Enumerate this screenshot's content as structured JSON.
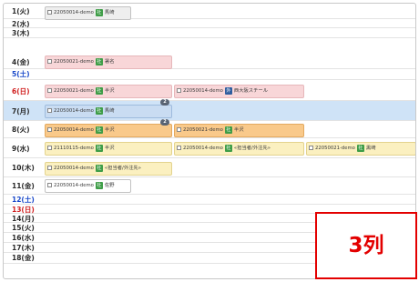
{
  "days": [
    {
      "label": "1(火)",
      "color": "default"
    },
    {
      "label": "2(水)",
      "color": "default"
    },
    {
      "label": "3(木)",
      "color": "default"
    },
    {
      "label": "4(金)",
      "color": "default"
    },
    {
      "label": "5(土)",
      "color": "blue"
    },
    {
      "label": "6(日)",
      "color": "red"
    },
    {
      "label": "7(月)",
      "color": "default",
      "selected": true
    },
    {
      "label": "8(火)",
      "color": "default"
    },
    {
      "label": "9(水)",
      "color": "default"
    },
    {
      "label": "10(木)",
      "color": "default"
    },
    {
      "label": "11(金)",
      "color": "default"
    },
    {
      "label": "12(土)",
      "color": "blue"
    },
    {
      "label": "13(日)",
      "color": "red"
    },
    {
      "label": "14(月)",
      "color": "default"
    },
    {
      "label": "15(火)",
      "color": "default"
    },
    {
      "label": "16(水)",
      "color": "default"
    },
    {
      "label": "17(木)",
      "color": "default"
    },
    {
      "label": "18(金)",
      "color": "default"
    }
  ],
  "entries": [
    {
      "day": "1(火)",
      "project": "22050014-demo",
      "badge": "社",
      "person": "馬崎",
      "color": "grey"
    },
    {
      "day": "4(金)",
      "project": "22050021-demo",
      "badge": "社",
      "person": "署名",
      "color": "pink"
    },
    {
      "day": "6(日)",
      "project": "22050021-demo",
      "badge": "社",
      "person": "半沢",
      "color": "pink"
    },
    {
      "day": "6(日)",
      "project": "22050014-demo",
      "badge": "外",
      "person": "西大阪スチール",
      "color": "pink"
    },
    {
      "day": "7(月)",
      "project": "22050014-demo",
      "badge": "社",
      "person": "馬崎",
      "color": "blue"
    },
    {
      "day": "8(火)",
      "project": "22050014-demo",
      "badge": "社",
      "person": "半沢",
      "color": "orange"
    },
    {
      "day": "8(火)",
      "project": "22050021-demo",
      "badge": "社",
      "person": "半沢",
      "color": "orange"
    },
    {
      "day": "9(水)",
      "project": "21110115-demo",
      "badge": "社",
      "person": "半沢",
      "color": "yellow"
    },
    {
      "day": "9(水)",
      "project": "22050014-demo",
      "badge": "社",
      "person": "«担当者/外注先»",
      "color": "yellow"
    },
    {
      "day": "9(水)",
      "project": "22050021-demo",
      "badge": "社",
      "person": "黒崎",
      "color": "yellow"
    },
    {
      "day": "10(木)",
      "project": "22050014-demo",
      "badge": "社",
      "person": "«担当者/外注先»",
      "color": "yellow"
    },
    {
      "day": "11(金)",
      "project": "22050014-demo",
      "badge": "社",
      "person": "佐野",
      "color": "white"
    }
  ],
  "bubbles": [
    "2",
    "2"
  ],
  "annotation": "3列",
  "colors": {
    "blue_day": "#1747c9",
    "red_day": "#d01e1e",
    "annotation": "#e30000",
    "badge": "#3e9d47"
  }
}
